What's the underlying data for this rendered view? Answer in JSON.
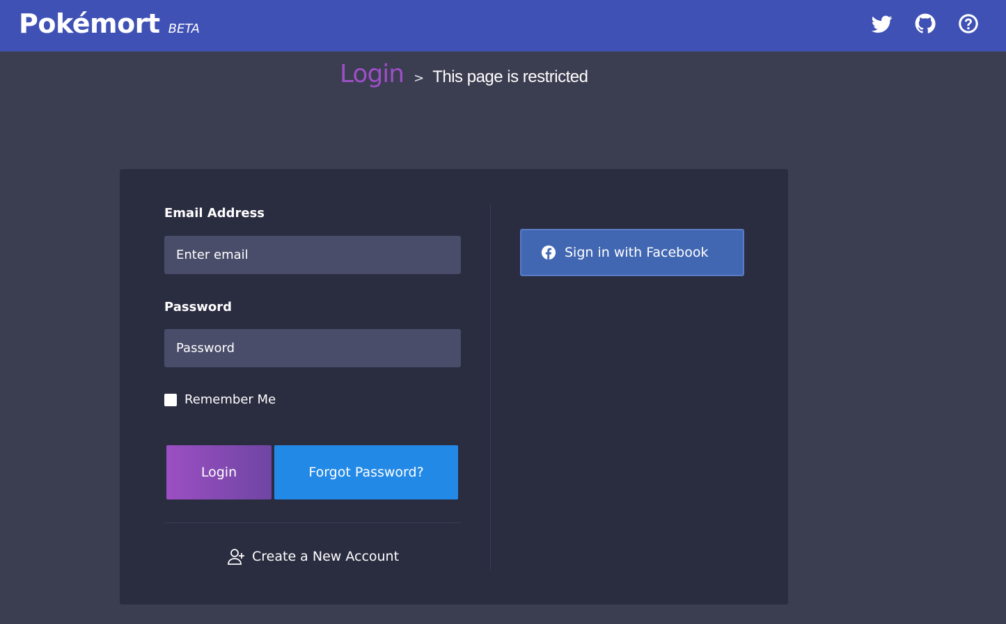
{
  "header": {
    "brand": "Pokémort",
    "badge": "BETA",
    "icons": [
      "twitter-icon",
      "github-icon",
      "help-icon"
    ]
  },
  "breadcrumb": {
    "title": "Login",
    "separator": ">",
    "subtitle": "This page is restricted"
  },
  "form": {
    "email_label": "Email Address",
    "email_placeholder": "Enter email",
    "email_value": "",
    "password_label": "Password",
    "password_placeholder": "Password",
    "password_value": "",
    "remember_label": "Remember Me",
    "remember_checked": false,
    "login_button": "Login",
    "forgot_button": "Forgot Password?",
    "create_account": "Create a New Account"
  },
  "social": {
    "facebook_button": "Sign in with Facebook"
  },
  "colors": {
    "header": "#3f51b5",
    "background": "#3b3d50",
    "card": "#2a2c40",
    "accent_purple": "#9c4fc6",
    "forgot_blue": "#2389e6",
    "facebook_blue": "#4267b2"
  }
}
